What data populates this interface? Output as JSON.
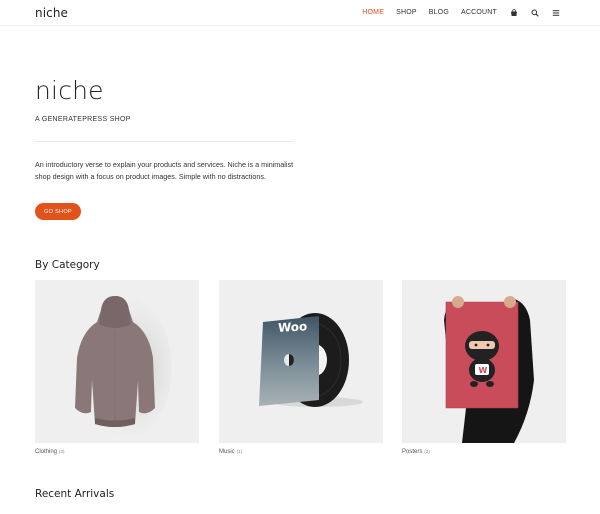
{
  "header": {
    "logo": "niche",
    "nav": [
      "HOME",
      "SHOP",
      "BLOG",
      "ACCOUNT"
    ],
    "icons": [
      "cart-icon",
      "search-icon",
      "menu-icon"
    ],
    "accent": "#e2521b"
  },
  "hero": {
    "title": "niche",
    "subtitle": "A GENERATEPRESS SHOP",
    "description": "An introductory verse to explain your products and services. Niche is a minimalist shop design with a focus on product images. Simple with no distractions.",
    "button": "GO SHOP"
  },
  "categories": {
    "heading": "By Category",
    "items": [
      {
        "name": "Clothing",
        "count": "(3)",
        "image": "hoodie"
      },
      {
        "name": "Music",
        "count": "(1)",
        "image": "vinyl-record"
      },
      {
        "name": "Posters",
        "count": "(3)",
        "image": "ninja-poster"
      }
    ]
  },
  "recent": {
    "heading": "Recent Arrivals"
  }
}
